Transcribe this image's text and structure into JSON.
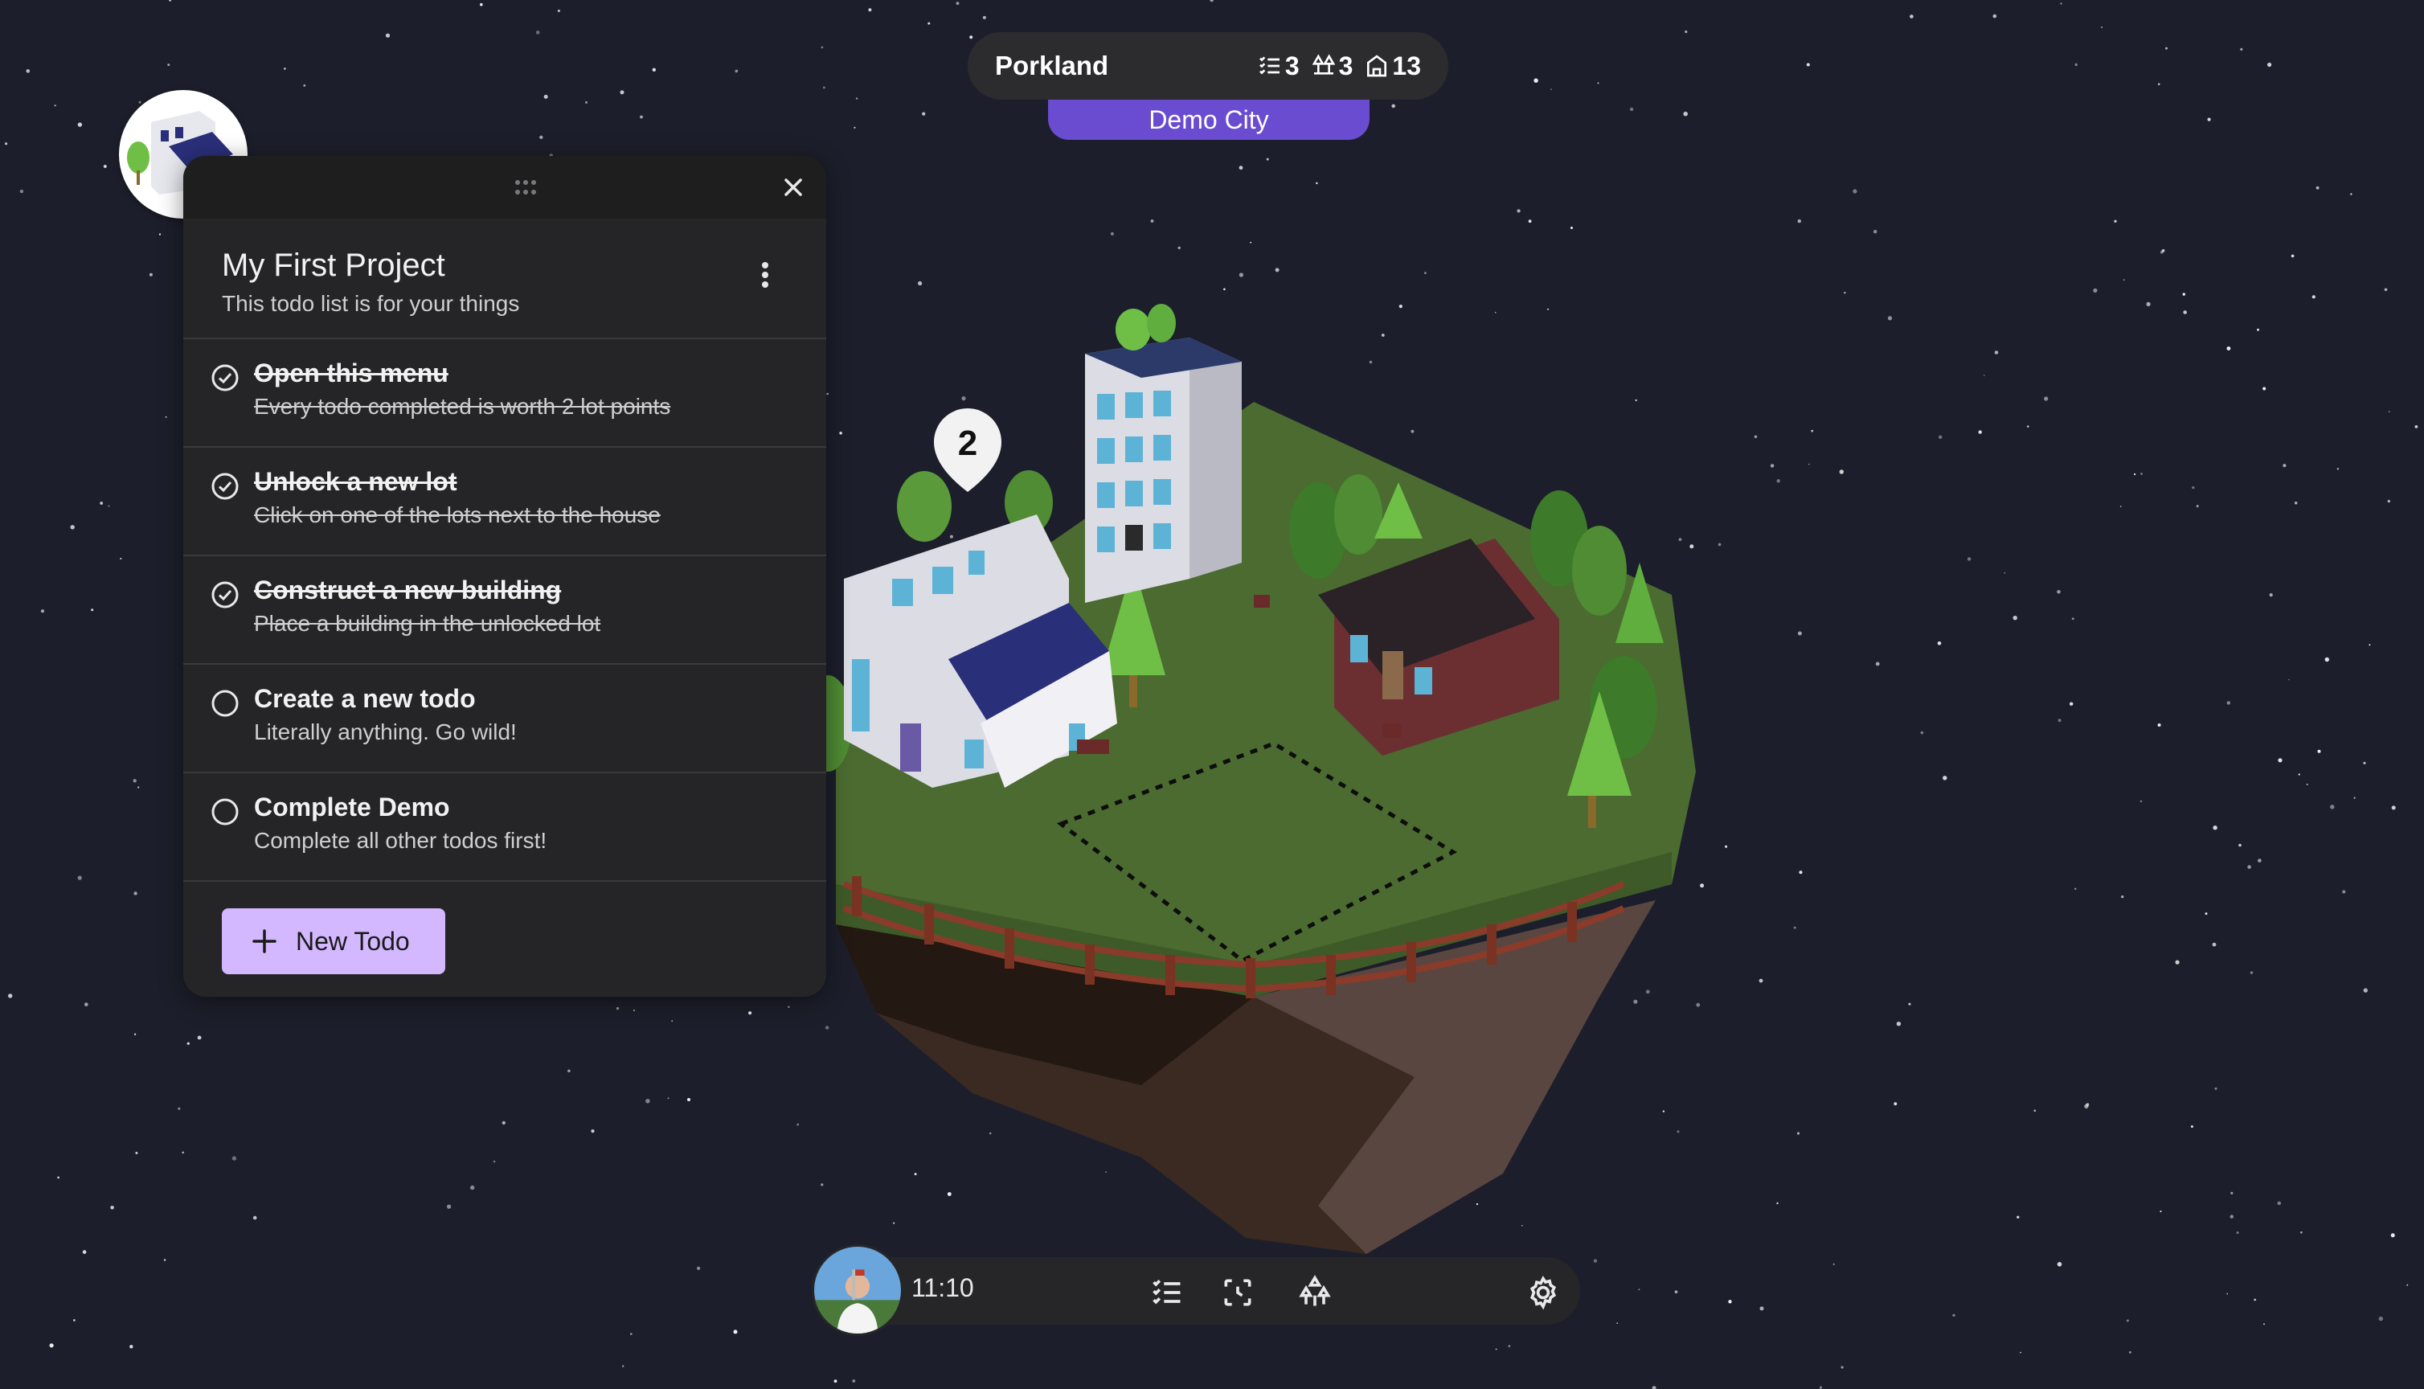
{
  "header": {
    "city_name": "Porkland",
    "stats": [
      {
        "icon": "checklist-icon",
        "value": "3"
      },
      {
        "icon": "trees-icon",
        "value": "3"
      },
      {
        "icon": "building-icon",
        "value": "13"
      }
    ],
    "city_tab": "Demo City"
  },
  "project": {
    "avatar_icon": "house-logo-icon",
    "title": "My First Project",
    "subtitle": "This todo list is for your things",
    "todos": [
      {
        "title": "Open this menu",
        "description": "Every todo completed is worth 2 lot points",
        "done": true
      },
      {
        "title": "Unlock a new lot",
        "description": "Click on one of the lots next to the house",
        "done": true
      },
      {
        "title": "Construct a new building",
        "description": "Place a building in the unlocked lot",
        "done": true
      },
      {
        "title": "Create a new todo",
        "description": "Literally anything. Go wild!",
        "done": false
      },
      {
        "title": "Complete Demo",
        "description": "Complete all other todos first!",
        "done": false
      }
    ],
    "new_todo_label": "New Todo"
  },
  "scene": {
    "lot_pin_value": "2"
  },
  "toolbar": {
    "time": "11:10",
    "icons": [
      "checklist-icon",
      "focus-icon",
      "trees-icon",
      "settings-icon"
    ]
  },
  "colors": {
    "background": "#1c1f2b",
    "accent_purple": "#6a4cd1",
    "button_lavender": "#d4b8ff",
    "panel": "#252527",
    "grass": "#4b6b30"
  }
}
